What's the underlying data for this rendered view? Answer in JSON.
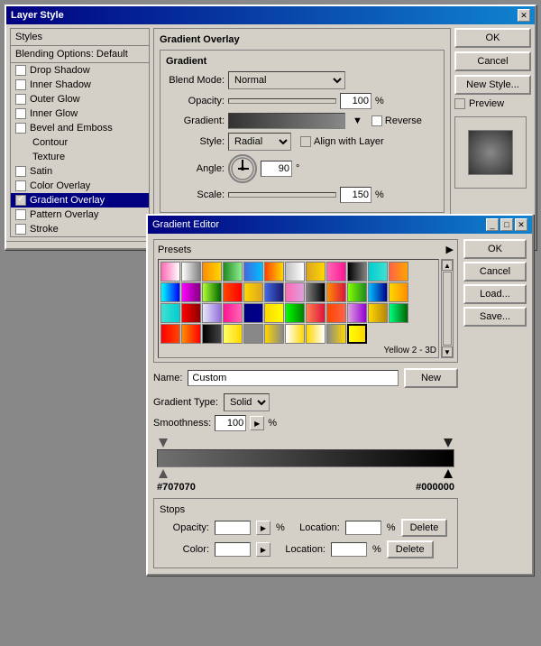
{
  "layerStyle": {
    "title": "Layer Style",
    "styles": {
      "header": "Styles",
      "blendingOptions": "Blending Options: Default",
      "items": [
        {
          "label": "Drop Shadow",
          "checked": false,
          "active": false
        },
        {
          "label": "Inner Shadow",
          "checked": false,
          "active": false
        },
        {
          "label": "Outer Glow",
          "checked": false,
          "active": false
        },
        {
          "label": "Inner Glow",
          "checked": false,
          "active": false
        },
        {
          "label": "Bevel and Emboss",
          "checked": false,
          "active": false
        },
        {
          "label": "Contour",
          "checked": false,
          "active": false,
          "sub": true
        },
        {
          "label": "Texture",
          "checked": false,
          "active": false,
          "sub": true
        },
        {
          "label": "Satin",
          "checked": false,
          "active": false
        },
        {
          "label": "Color Overlay",
          "checked": false,
          "active": false
        },
        {
          "label": "Gradient Overlay",
          "checked": true,
          "active": true
        },
        {
          "label": "Pattern Overlay",
          "checked": false,
          "active": false
        },
        {
          "label": "Stroke",
          "checked": false,
          "active": false
        }
      ]
    },
    "buttons": {
      "ok": "OK",
      "cancel": "Cancel",
      "newStyle": "New Style...",
      "preview": "Preview"
    },
    "gradientOverlay": {
      "title": "Gradient Overlay",
      "gradient": {
        "title": "Gradient",
        "blendModeLabel": "Blend Mode:",
        "blendMode": "Normal",
        "opacityLabel": "Opacity:",
        "opacity": "100",
        "percentSign": "%",
        "gradientLabel": "Gradient:",
        "reverseLabel": "Reverse",
        "styleLabel": "Style:",
        "style": "Radial",
        "alignWithLayerLabel": "Align with Layer",
        "angleLabel": "Angle:",
        "angleDegrees": "90",
        "degreeSign": "°",
        "scaleLabel": "Scale:",
        "scale": "150"
      }
    }
  },
  "gradientEditor": {
    "title": "Gradient Editor",
    "presets": {
      "title": "Presets",
      "label": "Yellow 2 - 3D",
      "items": [
        {
          "color": "linear-gradient(to right, #ff69b4, #ffffff)"
        },
        {
          "color": "linear-gradient(to right, #ffffff, #808080)"
        },
        {
          "color": "linear-gradient(to right, #ff8c00, #ffd700)"
        },
        {
          "color": "linear-gradient(to right, #228b22, #90ee90)"
        },
        {
          "color": "linear-gradient(to right, #4169e1, #00bfff)"
        },
        {
          "color": "linear-gradient(to right, #ff4500, #ffd700)"
        },
        {
          "color": "linear-gradient(to right, #c0c0c0, #ffffff)"
        },
        {
          "color": "linear-gradient(to right, #daa520, #ffd700)"
        },
        {
          "color": "linear-gradient(to right, #ff69b4, #ff1493)"
        },
        {
          "color": "linear-gradient(to right, #000000, #808080)"
        },
        {
          "color": "linear-gradient(to right, #00ced1, #40e0d0)"
        },
        {
          "color": "linear-gradient(to right, #ff6347, #ffa500)"
        },
        {
          "color": "linear-gradient(to right, #00ffff, #0000ff)"
        },
        {
          "color": "linear-gradient(to right, #ff00ff, #800080)"
        },
        {
          "color": "linear-gradient(to right, #adff2f, #006400)"
        },
        {
          "color": "linear-gradient(to right, #ff4500, #ff0000)"
        },
        {
          "color": "linear-gradient(to right, #ffd700, #daa520)"
        },
        {
          "color": "linear-gradient(to right, #4169e1, #191970)"
        },
        {
          "color": "linear-gradient(to right, #ff69b4, #dda0dd)"
        },
        {
          "color": "linear-gradient(to right, #808080, #000000)"
        },
        {
          "color": "linear-gradient(to right, #ff8c00, #dc143c)"
        },
        {
          "color": "linear-gradient(to right, #7fff00, #228b22)"
        },
        {
          "color": "linear-gradient(to right, #00bfff, #00008b)"
        },
        {
          "color": "linear-gradient(to right, #ffd700, #ff8c00)"
        },
        {
          "color": "linear-gradient(to right, #40e0d0, #00ced1)"
        },
        {
          "color": "linear-gradient(to right, #ff0000, #8b0000)"
        },
        {
          "color": "linear-gradient(to right, #e6e6fa, #9370db)"
        },
        {
          "color": "linear-gradient(to right, #ff1493, #ff69b4)"
        },
        {
          "color": "linear-gradient(to right, #000080, #00008b)"
        },
        {
          "color": "linear-gradient(to right, #ffd700, #ffff00)"
        },
        {
          "color": "linear-gradient(to right, #00ff00, #008000)"
        },
        {
          "color": "linear-gradient(to right, #ff7f50, #dc143c)"
        },
        {
          "color": "linear-gradient(to right, #ff4500, #ff6347)"
        },
        {
          "color": "linear-gradient(to right, #dda0dd, #9400d3)"
        },
        {
          "color": "linear-gradient(to right, #ffd700, #b8860b)"
        },
        {
          "color": "linear-gradient(to right, #00ff7f, #006400)"
        }
      ]
    },
    "nameLabel": "Name:",
    "nameValue": "Custom",
    "newButton": "New",
    "gradientTypeLabel": "Gradient Type:",
    "gradientType": "Solid",
    "smoothnessLabel": "Smoothness:",
    "smoothnessValue": "100",
    "percentSign": "%",
    "leftColor": "#707070",
    "rightColor": "#000000",
    "stops": {
      "title": "Stops",
      "opacityLabel": "Opacity:",
      "opacityLocationLabel": "Location:",
      "opacityPercentSign": "%",
      "opacityDeleteButton": "Delete",
      "colorLabel": "Color:",
      "colorLocationLabel": "Location:",
      "colorPercentSign": "%",
      "colorDeleteButton": "Delete"
    },
    "buttons": {
      "ok": "OK",
      "cancel": "Cancel",
      "load": "Load...",
      "save": "Save..."
    }
  }
}
